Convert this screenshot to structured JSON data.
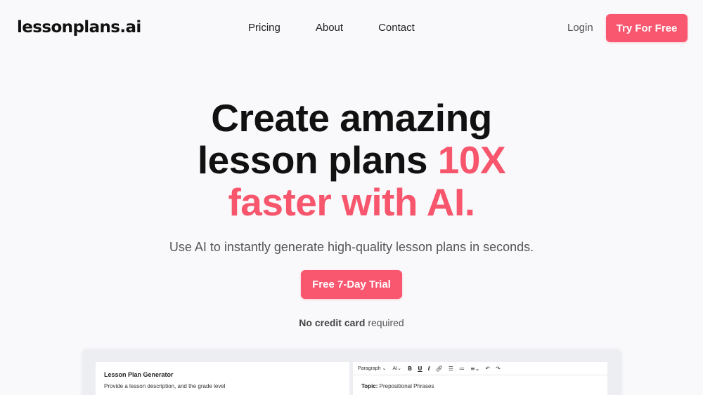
{
  "nav": {
    "logo": "lessonplans.ai",
    "links": [
      "Pricing",
      "About",
      "Contact"
    ],
    "login": "Login",
    "cta": "Try For Free"
  },
  "hero": {
    "line1": "Create amazing",
    "line2_main": "lesson plans",
    "line2_accent": "10X",
    "line3": "faster with AI.",
    "subtitle": "Use AI to instantly generate high-quality lesson plans in seconds.",
    "cta": "Free 7-Day Trial",
    "note_bold": "No credit card",
    "note_rest": "required"
  },
  "app_preview": {
    "left_title": "Lesson Plan Generator",
    "left_desc": "Provide a lesson description, and the grade level",
    "toolbar": {
      "paragraph": "Paragraph",
      "ai": "AI"
    },
    "topic_label": "Topic:",
    "topic_value": "Prepositional Phrases"
  },
  "colors": {
    "accent": "#f7566d",
    "button": "#f9566f",
    "background": "#f9f9fb"
  }
}
